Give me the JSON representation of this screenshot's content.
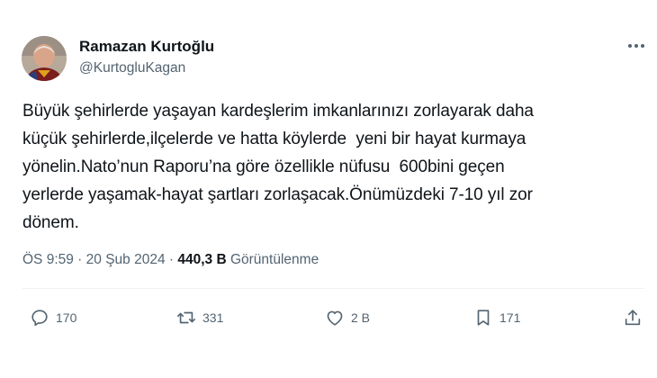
{
  "author": {
    "name": "Ramazan Kurtoğlu",
    "handle": "@KurtogluKagan",
    "avatar_icon": "user-avatar"
  },
  "tweet": {
    "lines": [
      "Büyük şehirlerde yaşayan kardeşlerim imkanlarınızı zorlayarak daha",
      "küçük şehirlerde,ilçelerde ve hatta köylerde  yeni bir hayat kurmaya",
      "yönelin.Nato’nun Raporu’na göre özellikle nüfusu  600bini geçen",
      "yerlerde yaşamak-hayat şartları zorlaşacak.Önümüzdeki 7-10 yıl zor",
      "dönem."
    ]
  },
  "meta": {
    "time": "ÖS 9:59",
    "sep1": " · ",
    "date": "20 Şub 2024",
    "sep2": " · ",
    "views_count": "440,3 B",
    "views_label": " Görüntülenme"
  },
  "actions": {
    "reply": {
      "icon": "reply-icon",
      "count": "170"
    },
    "retweet": {
      "icon": "retweet-icon",
      "count": "331"
    },
    "like": {
      "icon": "heart-icon",
      "count": "2 B"
    },
    "bookmark": {
      "icon": "bookmark-icon",
      "count": "171"
    },
    "share": {
      "icon": "share-icon"
    }
  },
  "colors": {
    "text": "#0f1419",
    "secondary": "#536471",
    "divider": "#eff3f4"
  }
}
